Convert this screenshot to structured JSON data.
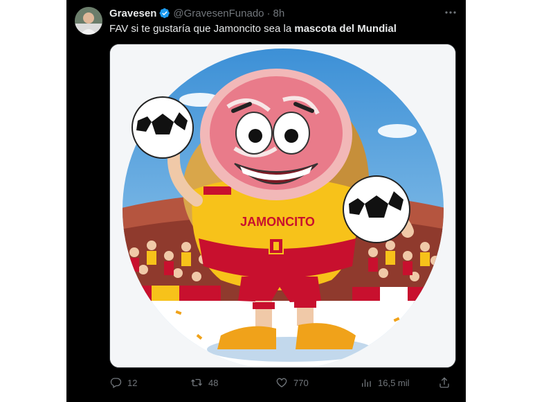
{
  "tweet": {
    "display_name": "Gravesen",
    "handle": "@GravesenFunado",
    "separator": "·",
    "time": "8h",
    "text_plain": "FAV si te gustaría que Jamoncito sea la ",
    "text_bold": "mascota del Mundial",
    "verified": true,
    "more_icon": "more-icon"
  },
  "media": {
    "jersey_text": "JAMONCITO",
    "description_icons": [
      "soccer-ball-icon",
      "spain-crest-icon"
    ]
  },
  "actions": {
    "replies": "12",
    "retweets": "48",
    "likes": "770",
    "views": "16,5 mil"
  },
  "colors": {
    "background": "#000000",
    "text": "#e7e9ea",
    "muted": "#71767b",
    "verified": "#1d9bf0",
    "jersey_red": "#c8102e",
    "jersey_yellow": "#f7c21a"
  }
}
